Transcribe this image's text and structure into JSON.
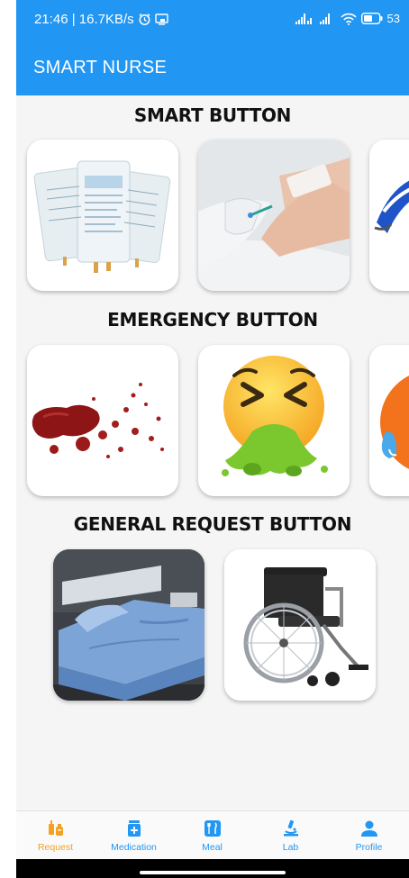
{
  "status_bar": {
    "time_speed": "21:46 | 16.7KB/s",
    "battery": "53"
  },
  "app_bar": {
    "title": "SMART NURSE"
  },
  "sections": [
    {
      "title": "SMART BUTTON"
    },
    {
      "title": "EMERGENCY BUTTON"
    },
    {
      "title": "GENERAL REQUEST BUTTON"
    }
  ],
  "tiles": {
    "smart": [
      "iv-bags-icon",
      "iv-cannula-icon",
      "partial-tile-icon"
    ],
    "emergency": [
      "bleeding-icon",
      "vomiting-face-icon",
      "crying-face-icon"
    ],
    "general": [
      "bed-icon",
      "wheelchair-icon"
    ]
  },
  "nav": {
    "items": [
      {
        "label": "Request",
        "icon": "request-icon",
        "active": true
      },
      {
        "label": "Medication",
        "icon": "medication-icon"
      },
      {
        "label": "Meal",
        "icon": "meal-icon"
      },
      {
        "label": "Lab",
        "icon": "lab-icon"
      },
      {
        "label": "Profile",
        "icon": "profile-icon"
      }
    ],
    "active_color": "#f4a020",
    "color": "#2196f3"
  },
  "colors": {
    "primary": "#2196f3",
    "background": "#f5f5f5"
  }
}
